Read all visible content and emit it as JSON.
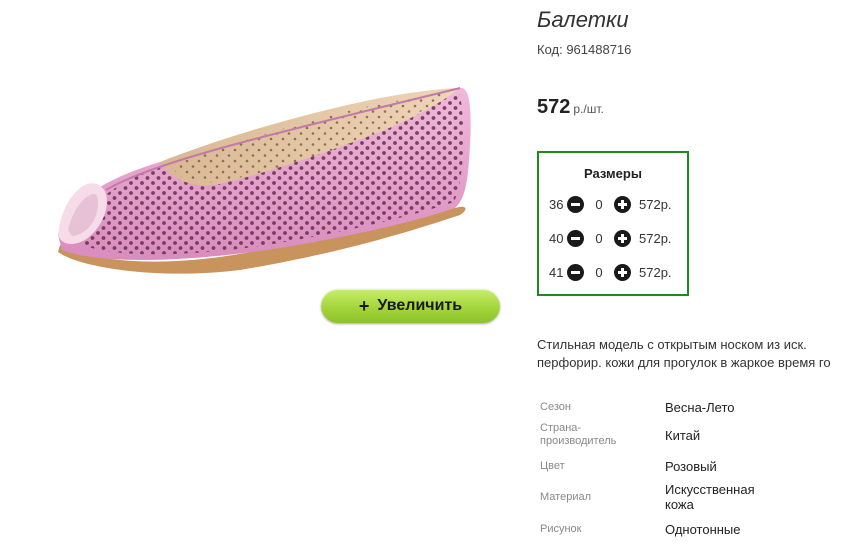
{
  "product": {
    "title": "Балетки",
    "code": "Код: 961488716",
    "price": "572",
    "price_unit": "р./шт.",
    "zoom_label": "Увеличить",
    "zoom_icon": "plus-icon",
    "image_icon": "pink-perforated-ballet-flat",
    "description": [
      "Стильная модель с открытым носком из иск.",
      "перфорир. кожи для прогулок в жаркое время го"
    ]
  },
  "sizes": {
    "title": "Размеры",
    "rows": [
      {
        "size": "36",
        "qty": "0",
        "price": "572р."
      },
      {
        "size": "40",
        "qty": "0",
        "price": "572р."
      },
      {
        "size": "41",
        "qty": "0",
        "price": "572р."
      }
    ]
  },
  "attributes": [
    {
      "label": "Сезон",
      "value": "Весна-Лето"
    },
    {
      "label": "Страна-производитель",
      "label_lines": [
        "Страна-",
        "производитель"
      ],
      "value": "Китай"
    },
    {
      "label": "Цвет",
      "value": "Розовый"
    },
    {
      "label": "Материал",
      "value": "Искусственная кожа",
      "value_lines": [
        "Искусственная",
        "кожа"
      ]
    },
    {
      "label": "Рисунок",
      "value": "Однотонные"
    }
  ],
  "colors": {
    "button_green": "#a3d63b",
    "sizes_border": "#1e8a1e",
    "shoe_pink": "#e8a6cf"
  }
}
